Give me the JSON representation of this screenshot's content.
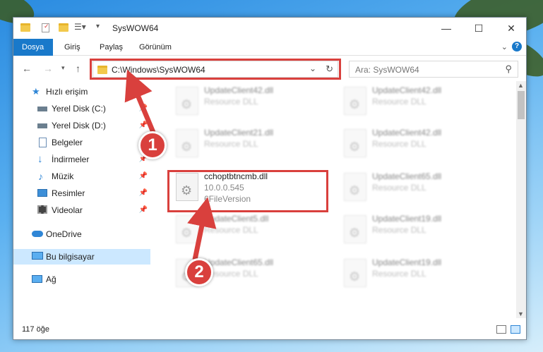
{
  "titlebar": {
    "title": "SysWOW64",
    "minimize_icon": "minimize-icon",
    "maximize_icon": "maximize-icon",
    "close_icon": "close-icon"
  },
  "ribbon": {
    "tabs": [
      "Dosya",
      "Giriş",
      "Paylaş",
      "Görünüm"
    ],
    "active_tab": "Dosya",
    "accent_color": "#1979ca"
  },
  "address": {
    "path": "C:\\Windows\\SysWOW64",
    "search_placeholder": "Ara: SysWOW64"
  },
  "sidebar": {
    "quick_access": "Hızlı erişim",
    "items": [
      {
        "label": "Yerel Disk (C:)",
        "icon": "drive-icon",
        "pinned": true
      },
      {
        "label": "Yerel Disk (D:)",
        "icon": "drive-icon",
        "pinned": true
      },
      {
        "label": "Belgeler",
        "icon": "documents-icon",
        "pinned": true
      },
      {
        "label": "İndirmeler",
        "icon": "download-icon",
        "pinned": true
      },
      {
        "label": "Müzik",
        "icon": "music-icon",
        "pinned": true
      },
      {
        "label": "Resimler",
        "icon": "pictures-icon",
        "pinned": true
      },
      {
        "label": "Videolar",
        "icon": "videos-icon",
        "pinned": true
      }
    ],
    "onedrive": "OneDrive",
    "this_pc": "Bu bilgisayar",
    "network": "Ağ"
  },
  "files": {
    "col1": [
      {
        "name": "UpdateClient42.dll",
        "type": "Resource DLL"
      },
      {
        "name": "UpdateClient21.dll",
        "type": "Resource DLL"
      },
      {
        "name": "cchoptbtncmb.dll",
        "version": "10.0.0.545",
        "desc": "6FileVersion"
      },
      {
        "name": "UpdateClient5.dll",
        "type": "Resource DLL"
      },
      {
        "name": "UpdateClient65.dll",
        "type": "Resource DLL"
      }
    ],
    "col2": [
      {
        "name": "UpdateClient42.dll",
        "type": "Resource DLL"
      },
      {
        "name": "UpdateClient42.dll",
        "type": "Resource DLL"
      },
      {
        "name": "UpdateClient65.dll",
        "type": "Resource DLL"
      },
      {
        "name": "UpdateClient19.dll",
        "type": "Resource DLL"
      },
      {
        "name": "UpdateClient19.dll",
        "type": "Resource DLL"
      }
    ]
  },
  "status": {
    "item_count": "117 öğe"
  },
  "callouts": [
    "1",
    "2"
  ],
  "highlight_color": "#d9403d"
}
